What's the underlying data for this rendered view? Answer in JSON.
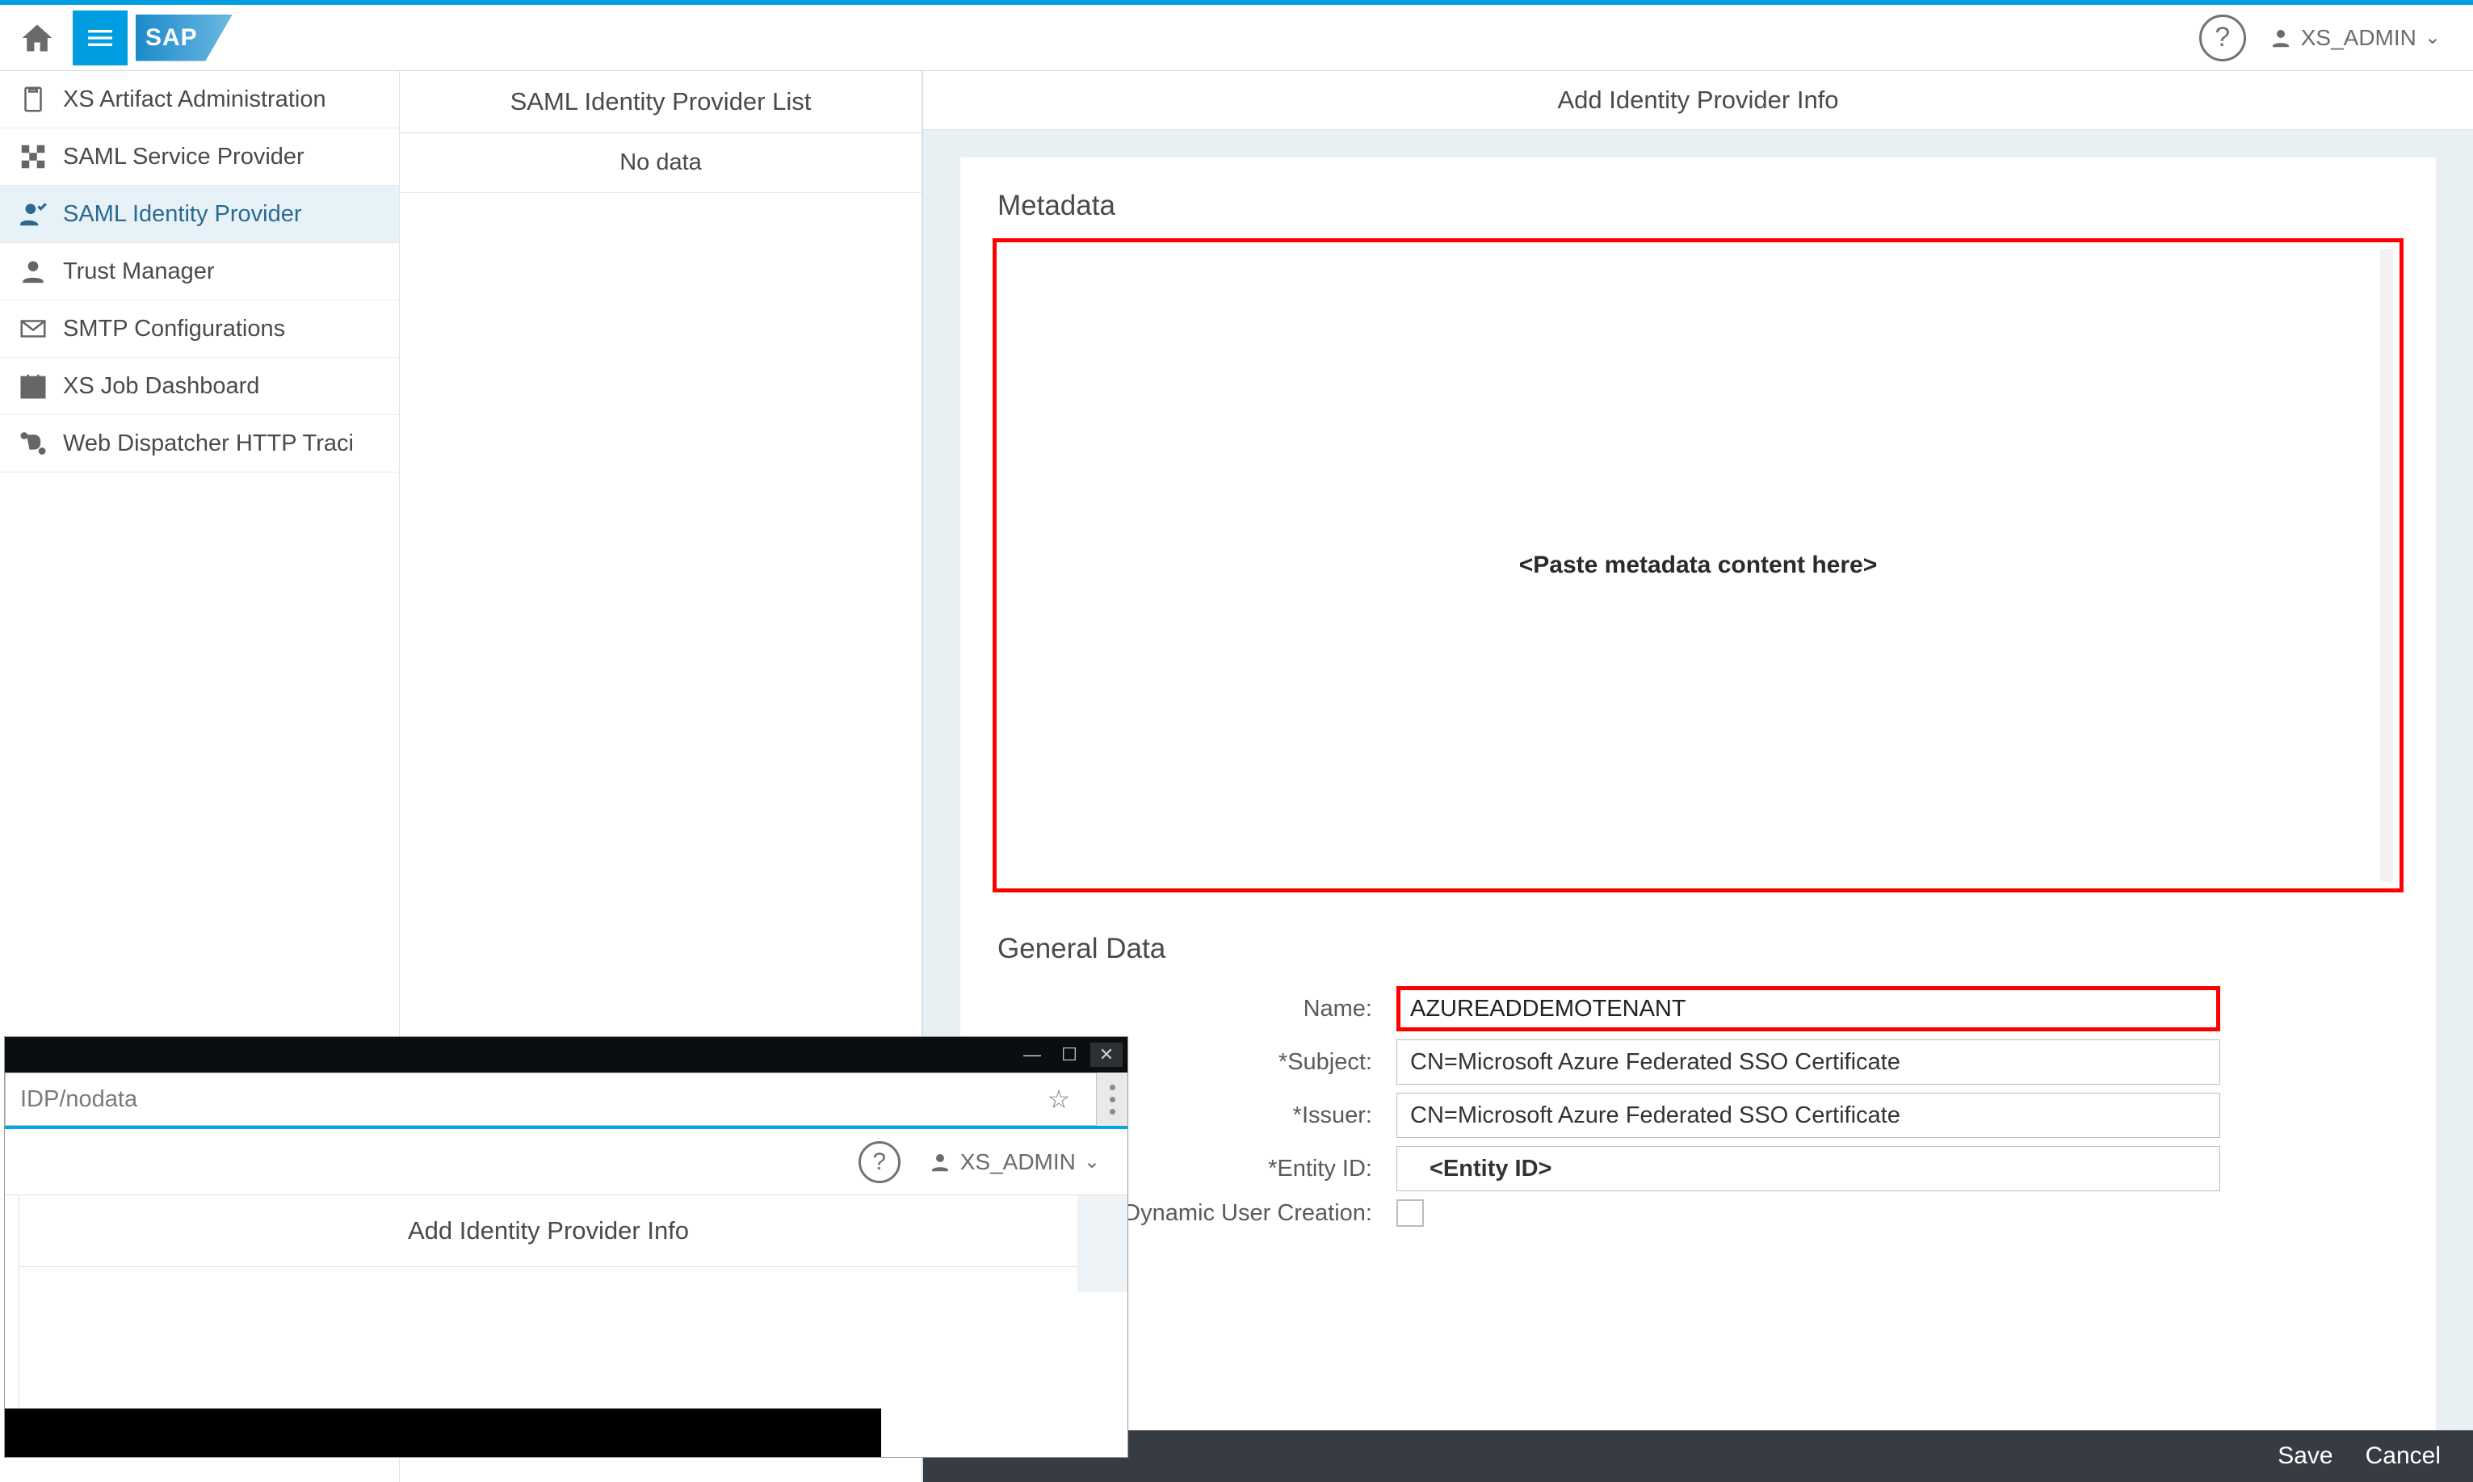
{
  "header": {
    "sap_logo_text": "SAP",
    "user_label": "XS_ADMIN"
  },
  "sidebar": {
    "items": [
      {
        "id": "xs-artifact-admin",
        "label": "XS Artifact Administration"
      },
      {
        "id": "saml-service-provider",
        "label": "SAML Service Provider"
      },
      {
        "id": "saml-identity-provider",
        "label": "SAML Identity Provider"
      },
      {
        "id": "trust-manager",
        "label": "Trust Manager"
      },
      {
        "id": "smtp-config",
        "label": "SMTP Configurations"
      },
      {
        "id": "xs-job-dashboard",
        "label": "XS Job Dashboard"
      },
      {
        "id": "web-dispatcher",
        "label": "Web Dispatcher HTTP Traci"
      }
    ]
  },
  "mid": {
    "title": "SAML Identity Provider List",
    "no_data": "No data"
  },
  "right": {
    "title": "Add Identity Provider Info",
    "metadata_section": "Metadata",
    "metadata_placeholder": "<Paste metadata content here>",
    "general_section": "General Data",
    "labels": {
      "name": "Name:",
      "subject": "*Subject:",
      "issuer": "*Issuer:",
      "entity_id": "*Entity ID:",
      "dyn_user": "Dynamic User Creation:"
    },
    "values": {
      "name": "AZUREADDEMOTENANT",
      "subject": "CN=Microsoft Azure Federated SSO Certificate",
      "issuer": "CN=Microsoft Azure Federated SSO Certificate",
      "entity_id": "<Entity ID>"
    }
  },
  "footer": {
    "save": "Save",
    "cancel": "Cancel"
  },
  "overlay": {
    "address": "IDP/nodata",
    "user_label": "XS_ADMIN",
    "title": "Add Identity Provider Info"
  }
}
